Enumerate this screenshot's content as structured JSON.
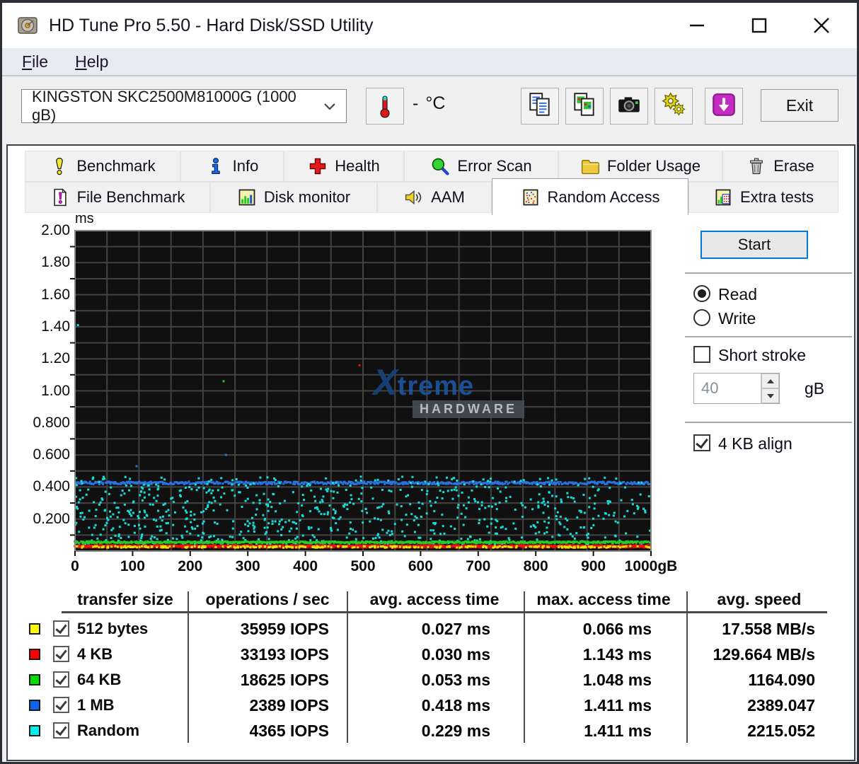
{
  "window": {
    "title": "HD Tune Pro 5.50 - Hard Disk/SSD Utility"
  },
  "menu": {
    "items": [
      {
        "label": "File"
      },
      {
        "label": "Help"
      }
    ]
  },
  "toolbar": {
    "drive_select": "KINGSTON SKC2500M81000G (1000 gB)",
    "temperature_value": "-",
    "temperature_unit": "°C",
    "buttons": [
      {
        "icon": "copy-text-icon"
      },
      {
        "icon": "copy-image-icon"
      },
      {
        "icon": "camera-icon"
      },
      {
        "icon": "gears-icon"
      },
      {
        "icon": "save-icon"
      }
    ],
    "exit_label": "Exit"
  },
  "tabs": {
    "row1": [
      {
        "label": "Benchmark",
        "icon": "exclamation-icon",
        "selected": false
      },
      {
        "label": "Info",
        "icon": "info-icon",
        "selected": false
      },
      {
        "label": "Health",
        "icon": "health-icon",
        "selected": false
      },
      {
        "label": "Error Scan",
        "icon": "error-scan-icon",
        "selected": false
      },
      {
        "label": "Folder Usage",
        "icon": "folder-icon",
        "selected": false
      },
      {
        "label": "Erase",
        "icon": "erase-icon",
        "selected": false
      }
    ],
    "row2": [
      {
        "label": "File Benchmark",
        "icon": "file-benchmark-icon",
        "selected": false
      },
      {
        "label": "Disk monitor",
        "icon": "disk-monitor-icon",
        "selected": false
      },
      {
        "label": "AAM",
        "icon": "aam-icon",
        "selected": false
      },
      {
        "label": "Random Access",
        "icon": "random-access-icon",
        "selected": true
      },
      {
        "label": "Extra tests",
        "icon": "extra-tests-icon",
        "selected": false
      }
    ]
  },
  "panel": {
    "start_label": "Start",
    "read_label": "Read",
    "write_label": "Write",
    "read_selected": true,
    "short_stroke_label": "Short stroke",
    "short_stroke_checked": false,
    "capacity_value": "40",
    "capacity_unit": "gB",
    "align_label": "4 KB align",
    "align_checked": true
  },
  "chart_data": {
    "type": "scatter",
    "ylabel": "ms",
    "xlim": [
      0,
      1000
    ],
    "ylim": [
      0,
      2
    ],
    "y_ticks": [
      "2.00",
      "1.80",
      "1.60",
      "1.40",
      "1.20",
      "1.00",
      "0.800",
      "0.600",
      "0.400",
      "0.200"
    ],
    "x_ticks": [
      "0",
      "100",
      "200",
      "300",
      "400",
      "500",
      "600",
      "700",
      "800",
      "900",
      "1000gB"
    ],
    "plot_bg": "#101010",
    "grid_color": "#424242",
    "grid_divisions": {
      "x": 18,
      "y": 20
    },
    "series": [
      {
        "name": "512 bytes",
        "color": "#f0e400",
        "pattern": "sprinkle",
        "center": 0.026,
        "spread": 0.005,
        "count": 300
      },
      {
        "name": "4 KB",
        "color": "#ee1111",
        "pattern": "band",
        "center": 0.03,
        "spread": 0.007,
        "count": 1300
      },
      {
        "name": "64 KB",
        "color": "#22cc22",
        "pattern": "band",
        "center": 0.055,
        "spread": 0.005,
        "count": 800
      },
      {
        "name": "1 MB",
        "color": "#2b72e0",
        "pattern": "band",
        "center": 0.425,
        "spread": 0.008,
        "count": 650
      },
      {
        "name": "Random",
        "color": "#18dcd8",
        "pattern": "scatter",
        "min": 0.04,
        "max": 0.465,
        "count": 950
      }
    ],
    "outliers": [
      {
        "x": 5,
        "y": 1.41,
        "color": "#18dcd8"
      },
      {
        "x": 258,
        "y": 1.06,
        "color": "#22cc22"
      },
      {
        "x": 494,
        "y": 1.16,
        "color": "#ee1111"
      },
      {
        "x": 107,
        "y": 0.53,
        "color": "#2b72e0"
      },
      {
        "x": 262,
        "y": 0.6,
        "color": "#2b72e0"
      }
    ],
    "watermark": {
      "line1": "Xtreme",
      "line2": "HARDWARE"
    }
  },
  "table": {
    "headers": [
      "transfer size",
      "operations / sec",
      "avg. access time",
      "max. access time",
      "avg. speed"
    ],
    "rows": [
      {
        "color": "#ffff00",
        "checked": true,
        "label": "512 bytes",
        "ops": "35959 IOPS",
        "avg": "0.027 ms",
        "max": "0.066 ms",
        "speed": "17.558 MB/s"
      },
      {
        "color": "#ff0000",
        "checked": true,
        "label": "4 KB",
        "ops": "33193 IOPS",
        "avg": "0.030 ms",
        "max": "1.143 ms",
        "speed": "129.664 MB/s"
      },
      {
        "color": "#00dc00",
        "checked": true,
        "label": "64 KB",
        "ops": "18625 IOPS",
        "avg": "0.053 ms",
        "max": "1.048 ms",
        "speed": "1164.090"
      },
      {
        "color": "#0d62f0",
        "checked": true,
        "label": "1 MB",
        "ops": "2389 IOPS",
        "avg": "0.418 ms",
        "max": "1.411 ms",
        "speed": "2389.047"
      },
      {
        "color": "#00f0f0",
        "checked": true,
        "label": "Random",
        "ops": "4365 IOPS",
        "avg": "0.229 ms",
        "max": "1.411 ms",
        "speed": "2215.052"
      }
    ]
  }
}
